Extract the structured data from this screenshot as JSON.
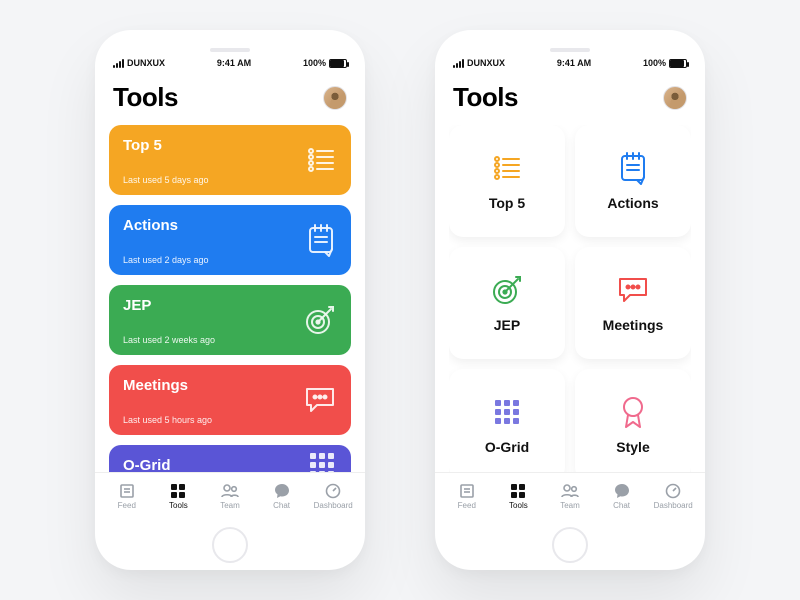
{
  "status": {
    "carrier": "DUNXUX",
    "time": "9:41 AM",
    "battery": "100%"
  },
  "header": {
    "title": "Tools"
  },
  "colors": {
    "orange": "#f5a623",
    "blue": "#1f7cf0",
    "green": "#3bab53",
    "red": "#f14e4b",
    "purple": "#5a55d6",
    "pink": "#f06a8d",
    "lilac": "#7a78e0"
  },
  "list_cards": [
    {
      "title": "Top 5",
      "meta": "Last used 5 days ago",
      "color": "orange",
      "icon": "list-icon"
    },
    {
      "title": "Actions",
      "meta": "Last used 2 days ago",
      "color": "blue",
      "icon": "notepad-icon"
    },
    {
      "title": "JEP",
      "meta": "Last used 2 weeks ago",
      "color": "green",
      "icon": "target-icon"
    },
    {
      "title": "Meetings",
      "meta": "Last used 5 hours ago",
      "color": "red",
      "icon": "chat-icon"
    },
    {
      "title": "O-Grid",
      "meta": "",
      "color": "purple",
      "icon": "grid-icon"
    }
  ],
  "grid_cards": [
    {
      "label": "Top 5",
      "icon": "list-icon",
      "tint": "orange"
    },
    {
      "label": "Actions",
      "icon": "notepad-icon",
      "tint": "blue"
    },
    {
      "label": "JEP",
      "icon": "target-icon",
      "tint": "green"
    },
    {
      "label": "Meetings",
      "icon": "chat-icon",
      "tint": "red"
    },
    {
      "label": "O-Grid",
      "icon": "grid-icon",
      "tint": "lilac"
    },
    {
      "label": "Style",
      "icon": "ribbon-icon",
      "tint": "pink"
    }
  ],
  "tabs": [
    {
      "label": "Feed",
      "icon": "feed-icon"
    },
    {
      "label": "Tools",
      "icon": "tools-icon",
      "active": true
    },
    {
      "label": "Team",
      "icon": "team-icon"
    },
    {
      "label": "Chat",
      "icon": "chat-bubble-icon"
    },
    {
      "label": "Dashboard",
      "icon": "gauge-icon"
    }
  ]
}
